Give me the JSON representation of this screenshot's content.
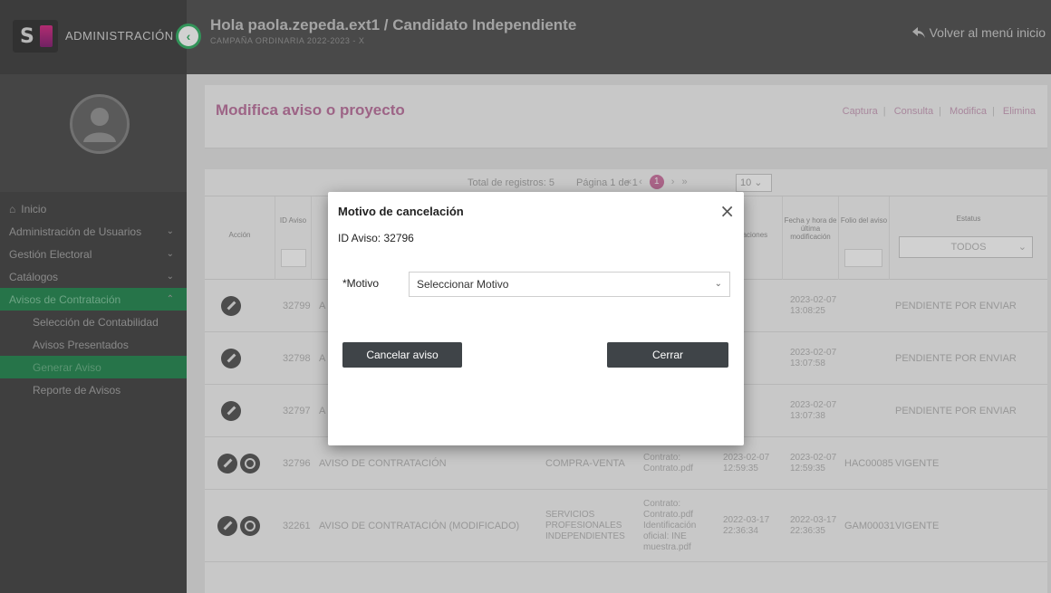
{
  "header": {
    "brand_title": "ADMINISTRACIÓN",
    "greeting": "Hola paola.zepeda.ext1 / Candidato Independiente",
    "process": "CAMPAÑA ORDINARIA 2022-2023 - X",
    "back_label": "Volver al menú inicio"
  },
  "sidebar": {
    "items": [
      {
        "label": "Inicio",
        "active": false
      },
      {
        "label": "Administración de Usuarios",
        "chevron": "⌄"
      },
      {
        "label": "Gestión Electoral",
        "chevron": "⌄"
      },
      {
        "label": "Catálogos",
        "chevron": "⌄"
      },
      {
        "label": "Avisos de Contratación",
        "chevron": "⌃"
      },
      {
        "label": "Selección de Contabilidad"
      },
      {
        "label": "Avisos Presentados"
      },
      {
        "label": "Generar Aviso"
      },
      {
        "label": "Reporte de Avisos"
      }
    ]
  },
  "panel": {
    "title": "Modifica aviso o proyecto",
    "tabs": [
      "Captura",
      "Consulta",
      "Modifica",
      "Elimina"
    ]
  },
  "pager": {
    "total": "Total de registros: 5",
    "page": "Página 1 de 1",
    "current": "1",
    "size": "10"
  },
  "table": {
    "headers": {
      "accion": "Acción",
      "id": "ID Aviso",
      "obs": "Observaciones",
      "fecha": "Fecha y hora de última modificación",
      "folio": "Folio del aviso",
      "estatus": "Estatus"
    },
    "status_filter": "TODOS",
    "rows": [
      {
        "id": "32799",
        "tipo": "A",
        "fecha": "2023-02-07 13:08:25",
        "folio": "",
        "estatus": "PENDIENTE POR ENVIAR"
      },
      {
        "id": "32798",
        "tipo": "A",
        "fecha": "2023-02-07 13:07:58",
        "folio": "",
        "estatus": "PENDIENTE POR ENVIAR"
      },
      {
        "id": "32797",
        "tipo": "A",
        "fecha": "2023-02-07 13:07:38",
        "folio": "",
        "estatus": "PENDIENTE POR ENVIAR"
      },
      {
        "id": "32796",
        "tipo": "AVISO DE CONTRATACIÓN",
        "categoria": "COMPRA-VENTA",
        "docs": "Contrato: Contrato.pdf",
        "fecha_reg": "2023-02-07 12:59:35",
        "fecha": "2023-02-07 12:59:35",
        "folio": "HAC00085",
        "estatus": "VIGENTE"
      },
      {
        "id": "32261",
        "tipo": "AVISO DE CONTRATACIÓN (MODIFICADO)",
        "categoria": "SERVICIOS PROFESIONALES INDEPENDIENTES",
        "docs": "Contrato: Contrato.pdf Identificación oficial: INE muestra.pdf",
        "fecha_reg": "2022-03-17 22:36:34",
        "fecha": "2022-03-17 22:36:35",
        "folio": "GAM00031",
        "estatus": "VIGENTE"
      }
    ]
  },
  "modal": {
    "title": "Motivo de cancelación",
    "close": "×",
    "id_label": "ID Aviso: 32796",
    "motivo_label": "*Motivo",
    "motivo_placeholder": "Seleccionar Motivo",
    "cancel_button": "Cancelar aviso",
    "close_button": "Cerrar"
  }
}
